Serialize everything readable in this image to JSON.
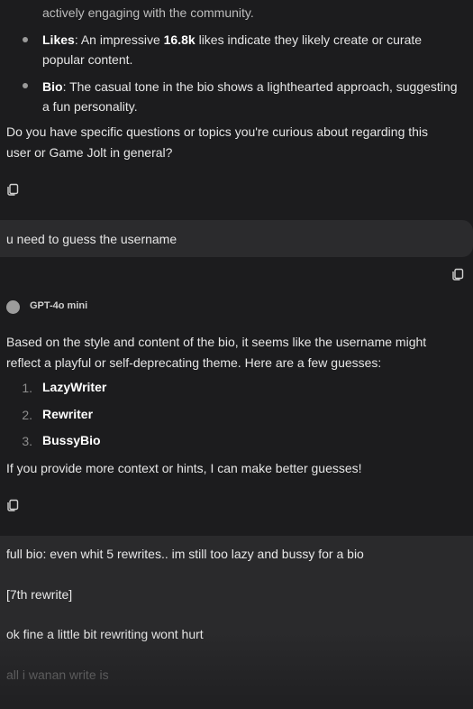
{
  "top_cut_text": "actively engaging with the community.",
  "bullets": [
    {
      "bold": "Likes",
      "text_a": ": An impressive ",
      "bold2": "16.8k",
      "text_b": " likes indicate they likely create or curate",
      "line2": "popular content."
    },
    {
      "bold": "Bio",
      "text_a": ": The casual tone in the bio shows a lighthearted approach, suggesting",
      "line2": "a fun personality."
    }
  ],
  "question_para": {
    "line1": "Do you have specific questions or topics you're curious about regarding this",
    "line2": "user or Game Jolt in general?"
  },
  "user_message_1": "u need to guess the username",
  "model_name": "GPT-4o mini",
  "reply_intro": {
    "line1": "Based on the style and content of the bio, it seems like the username might",
    "line2": "reflect a playful or self-deprecating theme. Here are a few guesses:"
  },
  "guesses": [
    {
      "num": "1.",
      "name": "LazyWriter"
    },
    {
      "num": "2.",
      "name": "Rewriter"
    },
    {
      "num": "3.",
      "name": "BussyBio"
    }
  ],
  "reply_outro": "If you provide more context or hints, I can make better guesses!",
  "user_message_2": {
    "l1": "full bio: even whit 5 rewrites.. im still too lazy and bussy for a bio",
    "l2": "[7th rewrite]",
    "l3": "ok fine a little bit rewriting wont hurt",
    "l4": "all i wanan write is"
  },
  "colors": {
    "background": "#1c1c1e",
    "bubble": "#2b2b2d",
    "text": "#e6e6e6",
    "muted": "#8e8e8e"
  },
  "icons": [
    "copy-icon"
  ]
}
